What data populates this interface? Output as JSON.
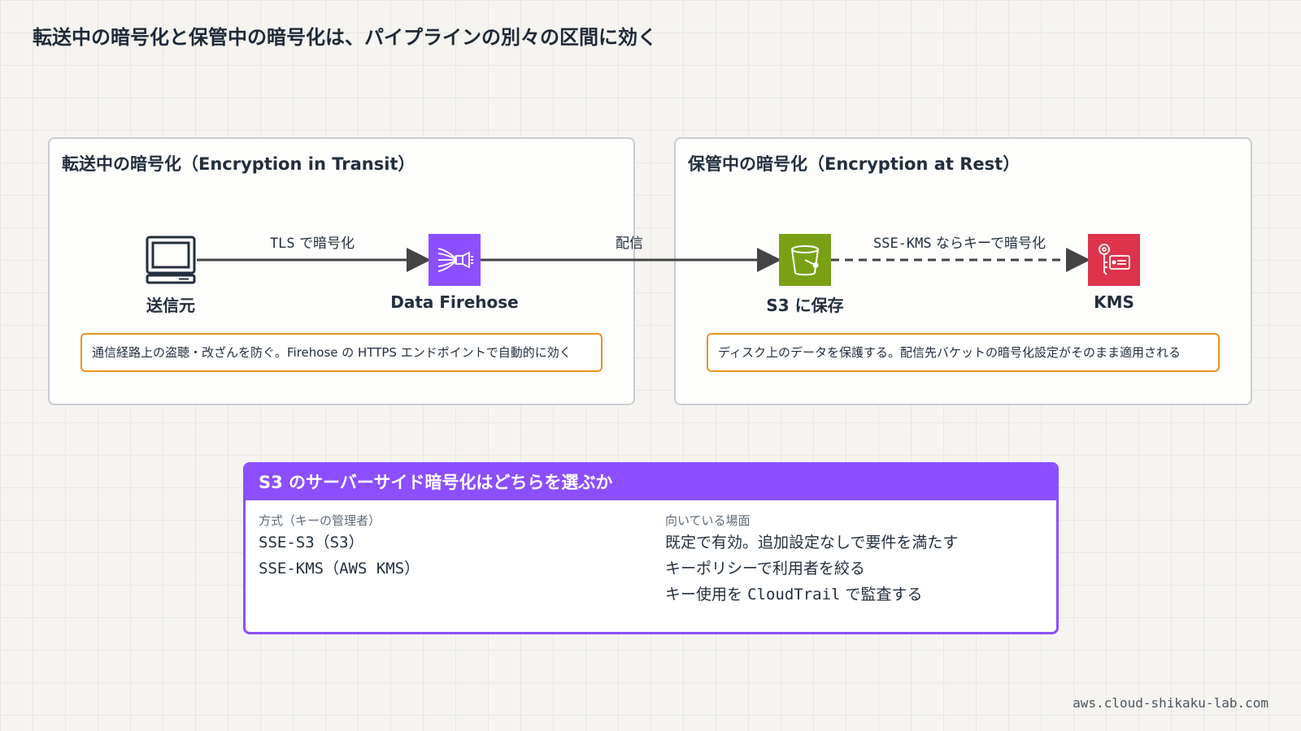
{
  "title": "転送中の暗号化と保管中の暗号化は、パイプラインの別々の区間に効く",
  "panels": {
    "transit": {
      "title": "転送中の暗号化（Encryption in Transit）",
      "note": "通信経路上の盗聴・改ざんを防ぐ。Firehose の HTTPS エンドポイントで自動的に効く"
    },
    "rest": {
      "title": "保管中の暗号化（Encryption at Rest）",
      "note": "ディスク上のデータを保護する。配信先バケットの暗号化設定がそのまま適用される"
    }
  },
  "nodes": {
    "source": {
      "label": "送信元",
      "icon": "computer-icon"
    },
    "firehose": {
      "label": "Data Firehose",
      "icon": "firehose-icon",
      "color": "#8c4fff"
    },
    "s3": {
      "label": "S3 に保存",
      "icon": "s3-bucket-icon",
      "color": "#7aa116"
    },
    "kms": {
      "label": "KMS",
      "icon": "kms-key-icon",
      "color": "#dd344c"
    }
  },
  "edges": {
    "tls": {
      "code": "TLS",
      "text": "で暗号化"
    },
    "deliver": {
      "text": "配信"
    },
    "ssekms": {
      "code": "SSE-KMS",
      "text": "ならキーで暗号化"
    }
  },
  "table": {
    "title": "S3 のサーバーサイド暗号化はどちらを選ぶか",
    "col_method": "方式（キーの管理者）",
    "col_use": "向いている場面",
    "methods": [
      "SSE-S3（S3）",
      "SSE-KMS（AWS KMS）"
    ],
    "uses": [
      "既定で有効。追加設定なしで要件を満たす",
      "キーポリシーで利用者を絞る"
    ],
    "use3_pre": "キー使用を",
    "use3_code": "CloudTrail",
    "use3_post": "で監査する"
  },
  "footer": "aws.cloud-shikaku-lab.com",
  "colors": {
    "accent_purple": "#8c4fff",
    "note_border": "#e8931e",
    "panel_border": "#c9cdd2",
    "arrow": "#444444"
  }
}
